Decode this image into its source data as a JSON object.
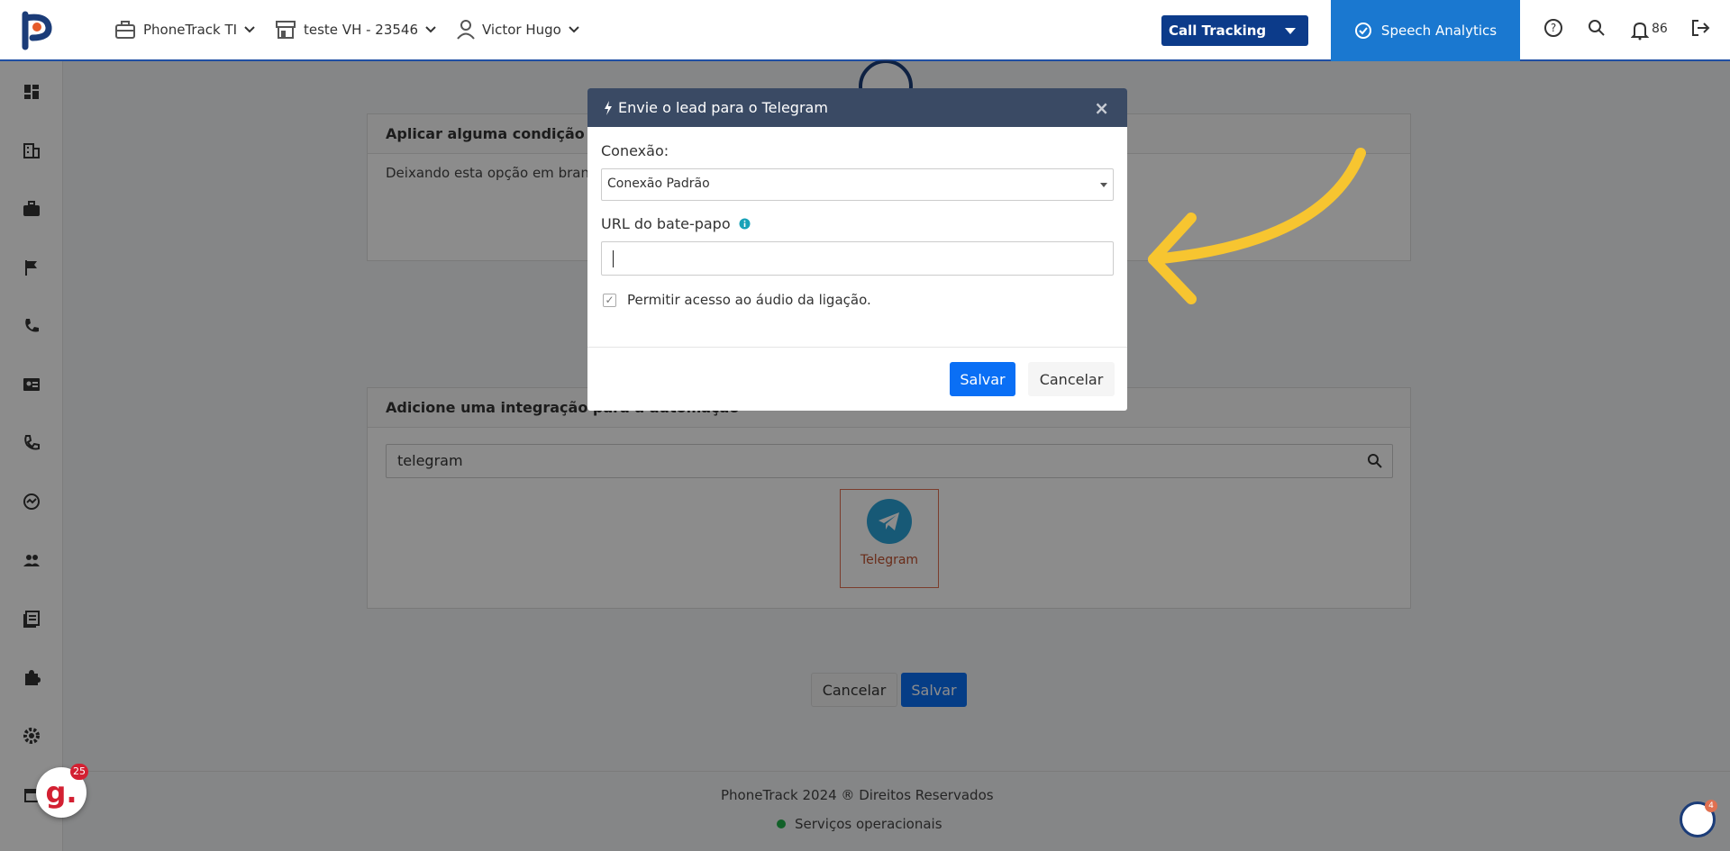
{
  "header": {
    "company": "PhoneTrack TI",
    "store": "teste VH - 23546",
    "user": "Victor Hugo",
    "product_select": "Call Tracking",
    "speech_label": "Speech Analytics",
    "notifications": "86"
  },
  "page": {
    "condition_title": "Aplicar alguma condição para a automação",
    "condition_text": "Deixando esta opção em branco, a automação será aplicada a todos os leads independente do status.",
    "integration_title": "Adicione uma integração para a automação",
    "search_value": "telegram",
    "integration_tile": "Telegram",
    "cancel_label": "Cancelar",
    "save_label": "Salvar"
  },
  "footer": {
    "copyright": "PhoneTrack 2024 ® Direitos Reservados",
    "status": "Serviços operacionais"
  },
  "modal": {
    "title": "Envie o lead para o Telegram",
    "connection_label": "Conexão:",
    "connection_value": "Conexão Padrão",
    "url_label": "URL do bate-papo",
    "url_value": "",
    "audio_label": "Permitir acesso ao áudio da ligação.",
    "save_label": "Salvar",
    "cancel_label": "Cancelar"
  },
  "widgets": {
    "g_count": "25",
    "p_count": "4"
  },
  "colors": {
    "brand_blue": "#0c3b8a",
    "primary_button": "#0a6ff5",
    "speech_bg": "#1a78d0",
    "modal_header": "#3a4a64",
    "arrow": "#f7c530"
  }
}
